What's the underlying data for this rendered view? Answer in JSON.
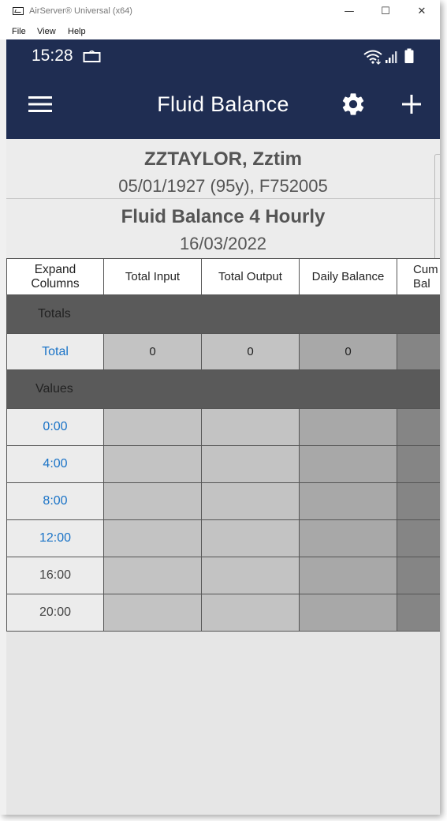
{
  "window": {
    "title": "AirServer® Universal (x64)",
    "minimize_glyph": "—",
    "maximize_glyph": "☐",
    "close_glyph": "✕"
  },
  "menu": [
    "File",
    "View",
    "Help"
  ],
  "status_bar": {
    "time": "15:28",
    "icons": [
      "cast-icon",
      "wifi-icon",
      "signal-icon",
      "battery-icon"
    ]
  },
  "app_bar": {
    "title": "Fluid Balance",
    "icons": [
      "menu-icon",
      "settings-icon",
      "add-icon"
    ]
  },
  "patient": {
    "name": "ZZTAYLOR, Zztim",
    "details": "05/01/1927 (95y), F752005"
  },
  "chart": {
    "title": "Fluid Balance 4 Hourly",
    "date": "16/03/2022"
  },
  "table": {
    "expand_label": "Expand\nColumns",
    "columns": [
      "Total Input",
      "Total Output",
      "Daily Balance",
      "Cumulative Balance"
    ],
    "column_visible_text": [
      "Total Input",
      "Total Output",
      "Daily Balance",
      "Cum\nBal"
    ],
    "totals_section": "Totals",
    "values_section": "Values",
    "totals_row": {
      "label": "Total",
      "values": [
        "0",
        "0",
        "0",
        ""
      ]
    },
    "value_rows": [
      {
        "label": "0:00",
        "link": true
      },
      {
        "label": "4:00",
        "link": true
      },
      {
        "label": "8:00",
        "link": true
      },
      {
        "label": "12:00",
        "link": true
      },
      {
        "label": "16:00",
        "link": false
      },
      {
        "label": "20:00",
        "link": false
      }
    ]
  },
  "colors": {
    "header_bg": "#1f2d52",
    "link": "#1a73c7",
    "section_bg": "#5a5a5a",
    "cell_col1": "#c3c3c3",
    "cell_col2": "#c3c3c3",
    "cell_col3": "#a8a8a8",
    "cell_col4": "#858585"
  }
}
